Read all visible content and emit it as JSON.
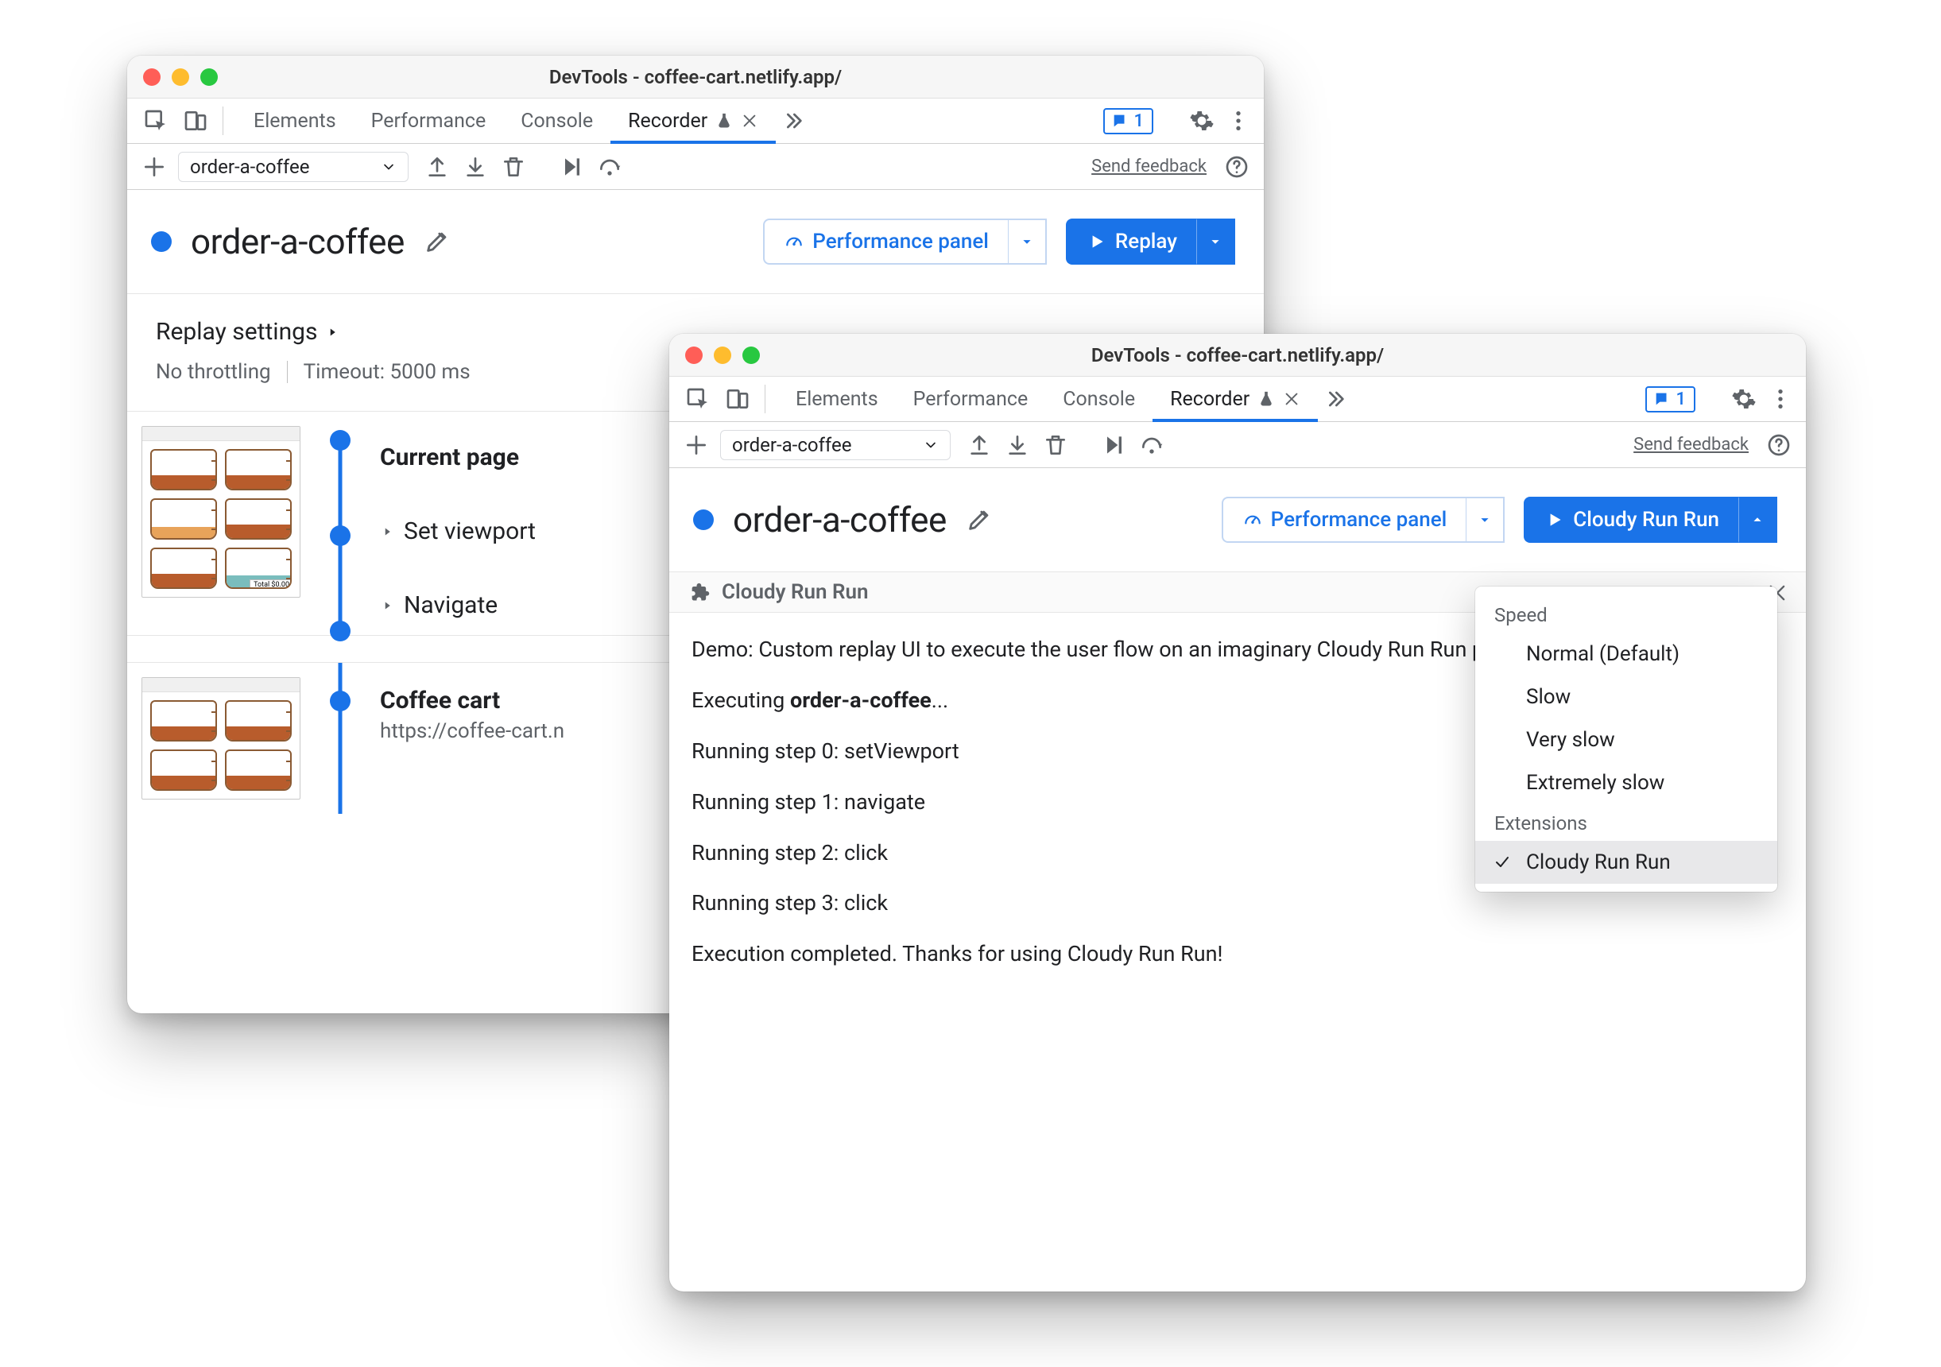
{
  "window_title": "DevTools - coffee-cart.netlify.app/",
  "tabs": {
    "elements": "Elements",
    "performance": "Performance",
    "console": "Console",
    "recorder": "Recorder"
  },
  "issues_count": "1",
  "toolbar": {
    "recording_name": "order-a-coffee",
    "feedback": "Send feedback"
  },
  "recording": {
    "title": "order-a-coffee"
  },
  "buttons": {
    "perf_panel": "Performance panel",
    "replay": "Replay",
    "cloudy": "Cloudy Run Run"
  },
  "settings": {
    "heading": "Replay settings",
    "throttling": "No throttling",
    "timeout": "Timeout: 5000 ms"
  },
  "steps": {
    "current_page": "Current page",
    "set_viewport": "Set viewport",
    "navigate": "Navigate",
    "coffee_cart": "Coffee cart",
    "coffee_cart_url": "https://coffee-cart.n"
  },
  "plugin": {
    "title": "Cloudy Run Run",
    "demo_line": "Demo: Custom replay UI to execute the user flow on an imaginary Cloudy Run Run platform.",
    "exec_prefix": "Executing ",
    "exec_name": "order-a-coffee",
    "exec_suffix": "...",
    "step0": "Running step 0: setViewport",
    "step1": "Running step 1: navigate",
    "step2": "Running step 2: click",
    "step3": "Running step 3: click",
    "done": "Execution completed. Thanks for using Cloudy Run Run!"
  },
  "dropdown": {
    "group_speed": "Speed",
    "speed_normal": "Normal (Default)",
    "speed_slow": "Slow",
    "speed_very_slow": "Very slow",
    "speed_extremely_slow": "Extremely slow",
    "group_extensions": "Extensions",
    "ext_cloudy": "Cloudy Run Run"
  }
}
